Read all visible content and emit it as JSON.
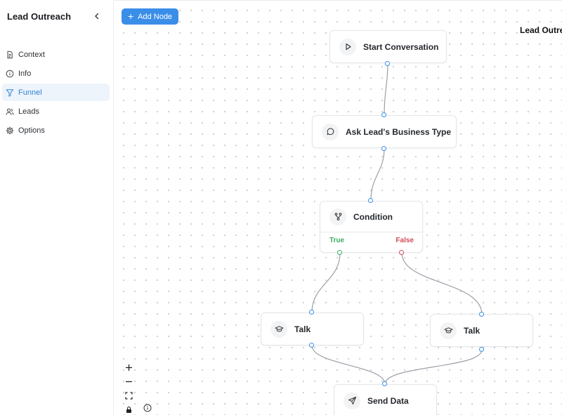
{
  "sidebar": {
    "title": "Lead Outreach",
    "items": [
      {
        "label": "Context",
        "icon": "document-icon",
        "active": false
      },
      {
        "label": "Info",
        "icon": "info-icon",
        "active": false
      },
      {
        "label": "Funnel",
        "icon": "funnel-icon",
        "active": true
      },
      {
        "label": "Leads",
        "icon": "users-icon",
        "active": false
      },
      {
        "label": "Options",
        "icon": "gear-icon",
        "active": false
      }
    ]
  },
  "toolbar": {
    "add_node_label": "Add Node"
  },
  "header": {
    "right_title": "Lead Outre"
  },
  "nodes": {
    "start": {
      "label": "Start Conversation",
      "icon": "play-icon"
    },
    "ask": {
      "label": "Ask Lead's Business Type",
      "icon": "chat-bubble-icon"
    },
    "condition": {
      "label": "Condition",
      "icon": "branch-icon",
      "true_label": "True",
      "false_label": "False"
    },
    "talk_left": {
      "label": "Talk",
      "icon": "graduation-cap-icon"
    },
    "talk_right": {
      "label": "Talk",
      "icon": "graduation-cap-icon"
    },
    "send": {
      "label": "Send Data",
      "icon": "send-icon"
    }
  },
  "colors": {
    "accent": "#3b8ee8",
    "true": "#3fae63",
    "false": "#d24a58",
    "active_bg": "#eef4fb"
  },
  "controls": [
    "zoom-in",
    "zoom-out",
    "fit-view",
    "lock",
    "info"
  ]
}
